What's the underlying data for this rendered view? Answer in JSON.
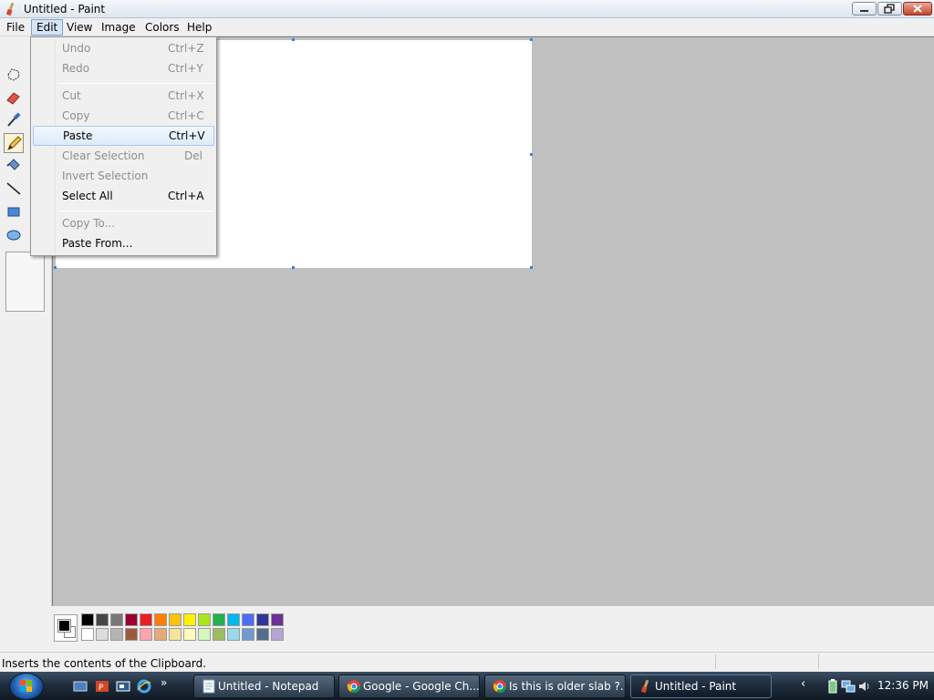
{
  "window": {
    "title": "Untitled - Paint",
    "controls": [
      "minimize",
      "restore",
      "close"
    ]
  },
  "menubar": {
    "items": [
      "File",
      "Edit",
      "View",
      "Image",
      "Colors",
      "Help"
    ],
    "active": "Edit"
  },
  "edit_menu": {
    "items": [
      {
        "label": "Undo",
        "shortcut": "Ctrl+Z",
        "enabled": false
      },
      {
        "label": "Redo",
        "shortcut": "Ctrl+Y",
        "enabled": false
      },
      {
        "label": "Cut",
        "shortcut": "Ctrl+X",
        "enabled": false
      },
      {
        "label": "Copy",
        "shortcut": "Ctrl+C",
        "enabled": false
      },
      {
        "label": "Paste",
        "shortcut": "Ctrl+V",
        "enabled": true,
        "highlighted": true
      },
      {
        "label": "Clear Selection",
        "shortcut": "Del",
        "enabled": false
      },
      {
        "label": "Invert Selection",
        "shortcut": "",
        "enabled": false
      },
      {
        "label": "Select All",
        "shortcut": "Ctrl+A",
        "enabled": true
      },
      {
        "label": "Copy To...",
        "shortcut": "",
        "enabled": false
      },
      {
        "label": "Paste From...",
        "shortcut": "",
        "enabled": true
      }
    ]
  },
  "toolbox": {
    "tools": [
      "free-form-select",
      "eraser",
      "pick-color",
      "pencil",
      "fill",
      "line",
      "rectangle",
      "ellipse"
    ],
    "selected": "pencil"
  },
  "palette": {
    "foreground": "#000000",
    "background": "#ffffff",
    "row1": [
      "#000000",
      "#464646",
      "#787878",
      "#990030",
      "#ed1c24",
      "#ff7e00",
      "#ffc20e",
      "#fff200",
      "#a8e61d",
      "#22b14c",
      "#00b7ef",
      "#4d6df3",
      "#2f3699",
      "#6f3198"
    ],
    "row2": [
      "#ffffff",
      "#dcdcdc",
      "#b4b4b4",
      "#9c5a3c",
      "#ffa3b1",
      "#e5aa7a",
      "#f5e49c",
      "#fff9bd",
      "#d3f9bc",
      "#9dbb61",
      "#99d9ea",
      "#709ad1",
      "#546d8e",
      "#b5a5d5"
    ]
  },
  "statusbar": {
    "text": "Inserts the contents of the Clipboard."
  },
  "taskbar": {
    "buttons": [
      {
        "label": "Untitled - Notepad",
        "icon": "notepad-icon"
      },
      {
        "label": "Google - Google Ch...",
        "icon": "chrome-icon"
      },
      {
        "label": "Is this is older slab ?...",
        "icon": "chrome-icon"
      },
      {
        "label": "Untitled - Paint",
        "icon": "paint-icon",
        "active": true
      }
    ],
    "clock": "12:36 PM"
  }
}
